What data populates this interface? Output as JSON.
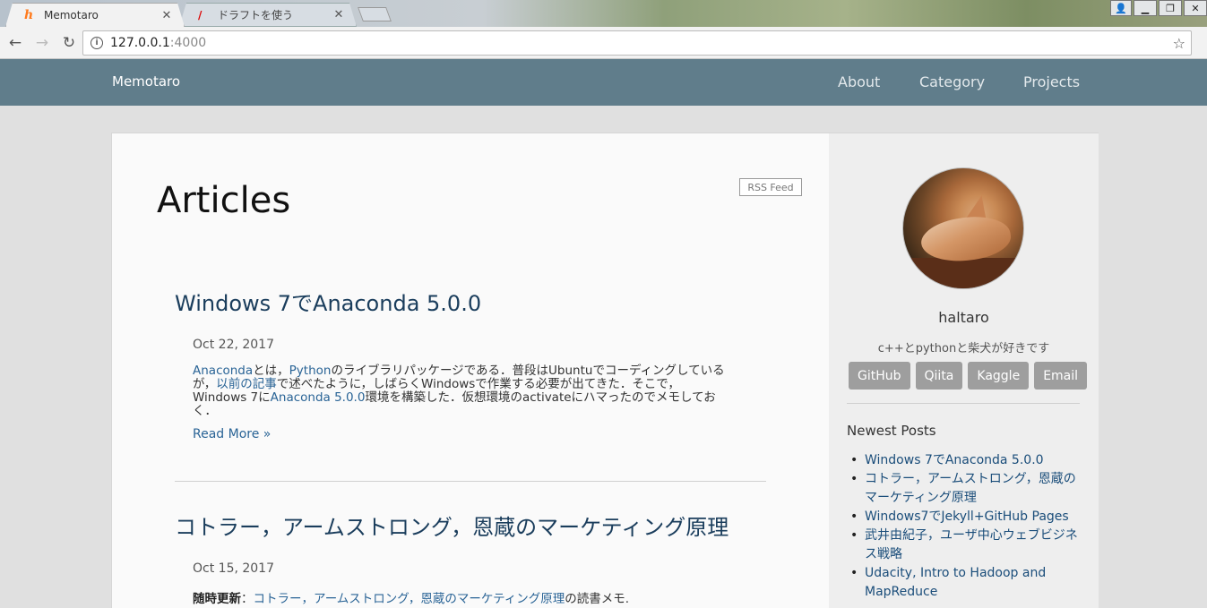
{
  "browser": {
    "tabs": [
      {
        "title": "Memotaro",
        "active": true,
        "favicon": "h"
      },
      {
        "title": "ドラフトを使う",
        "active": false,
        "favicon": "q"
      }
    ],
    "url_host": "127.0.0.1",
    "url_port": ":4000"
  },
  "site": {
    "brand": "Memotaro",
    "nav": [
      "About",
      "Category",
      "Projects"
    ]
  },
  "main": {
    "heading": "Articles",
    "rss_label": "RSS Feed",
    "posts": [
      {
        "title": "Windows 7でAnaconda 5.0.0",
        "date": "Oct 22, 2017",
        "excerpt": {
          "l1_link1": "Anaconda",
          "l1_t1": "とは，",
          "l1_link2": "Python",
          "l1_t2": "のライブラリパッケージである．普段はUbuntuでコーディングしている",
          "l2_t1": "が，",
          "l2_link1": "以前の記事",
          "l2_t2": "で述べたように，しばらくWindowsで作業する必要が出てきた．そこで，",
          "l3_t1": "Windows 7に",
          "l3_link1": "Anaconda 5.0.0",
          "l3_t2": "環境を構築した．仮想環境のactivateにハマったのでメモしてお",
          "l4_t1": "く．"
        },
        "read_more": "Read More »"
      },
      {
        "title": "コトラー，アームストロング，恩蔵のマーケティング原理",
        "date": "Oct 15, 2017",
        "update_label": "随時更新",
        "update_sep": "：",
        "update_link": "コトラー，アームストロング，恩蔵のマーケティング原理",
        "update_tail": "の読書メモ."
      }
    ]
  },
  "sidebar": {
    "author": "haltaro",
    "bio": "c++とpythonと柴犬が好きです",
    "social": [
      "GitHub",
      "Qiita",
      "Kaggle",
      "Email"
    ],
    "newest_heading": "Newest Posts",
    "newest": [
      "Windows 7でAnaconda 5.0.0",
      "コトラー，アームストロング，恩蔵のマーケティング原理",
      "Windows7でJekyll+GitHub Pages",
      "武井由紀子，ユーザ中心ウェブビジネス戦略",
      "Udacity, Intro to Hadoop and MapReduce"
    ]
  }
}
